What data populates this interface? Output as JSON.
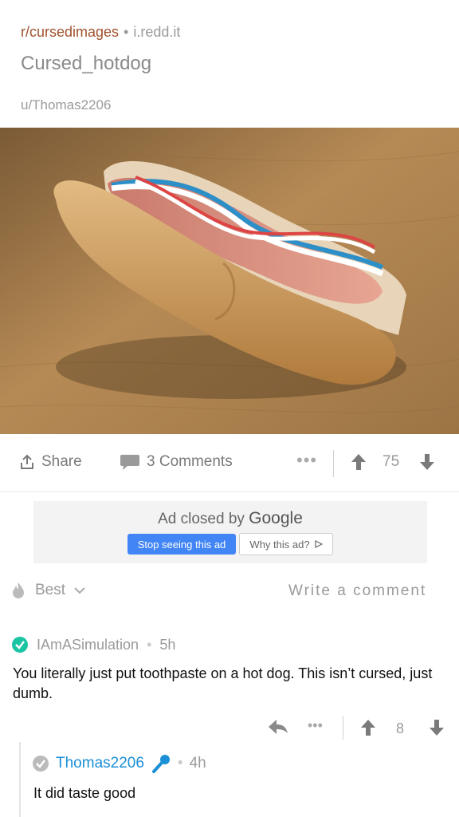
{
  "post": {
    "subreddit": "r/cursedimages",
    "domain": "i.redd.it",
    "title": "Cursed_hotdog",
    "author": "u/Thomas2206"
  },
  "actions": {
    "share_label": "Share",
    "comments_label": "3 Comments",
    "more_label": "•••",
    "score": "75"
  },
  "ad": {
    "text_prefix": "Ad closed by",
    "text_brand": "Google",
    "stop_label": "Stop seeing this ad",
    "why_label": "Why this ad?"
  },
  "sort": {
    "label": "Best",
    "write_comment": "Write a comment"
  },
  "comments": [
    {
      "user": "IAmASimulation",
      "age": "5h",
      "body": "You literally just put toothpaste on a hot dog. This isn’t cursed, just dumb.",
      "score": "8",
      "more_label": "•••"
    },
    {
      "user": "Thomas2206",
      "age": "4h",
      "body": "It did taste good"
    }
  ],
  "colors": {
    "subreddit": "#a0522d",
    "ad_button": "#4285f4",
    "verified": "#1bc5a4",
    "op_user": "#1a90d6"
  }
}
